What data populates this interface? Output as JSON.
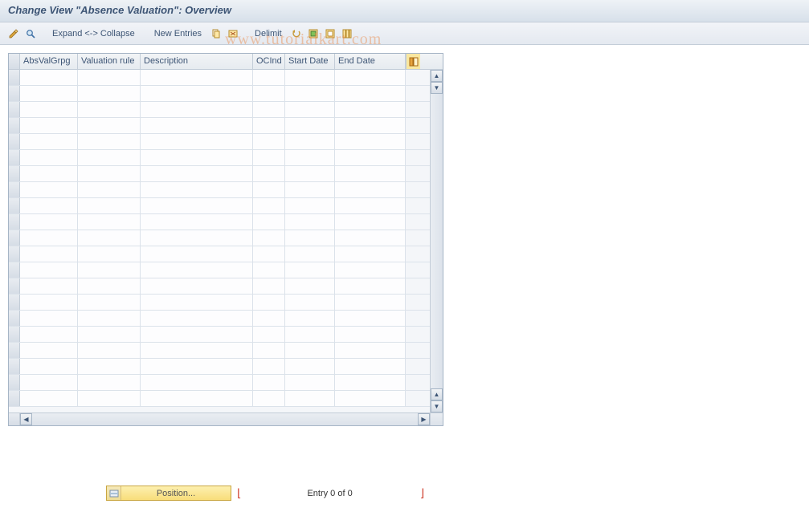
{
  "title": "Change View \"Absence Valuation\": Overview",
  "watermark": "www.tutorialkart.com",
  "toolbar": {
    "expand_collapse": "Expand <-> Collapse",
    "new_entries": "New Entries",
    "delimit": "Delimit"
  },
  "table": {
    "columns": {
      "c1": "AbsValGrpg",
      "c2": "Valuation rule",
      "c3": "Description",
      "c4": "OCInd",
      "c5": "Start Date",
      "c6": "End Date"
    },
    "visible_rows": 21,
    "rows": []
  },
  "footer": {
    "position_label": "Position...",
    "entry_text": "Entry 0 of 0"
  }
}
